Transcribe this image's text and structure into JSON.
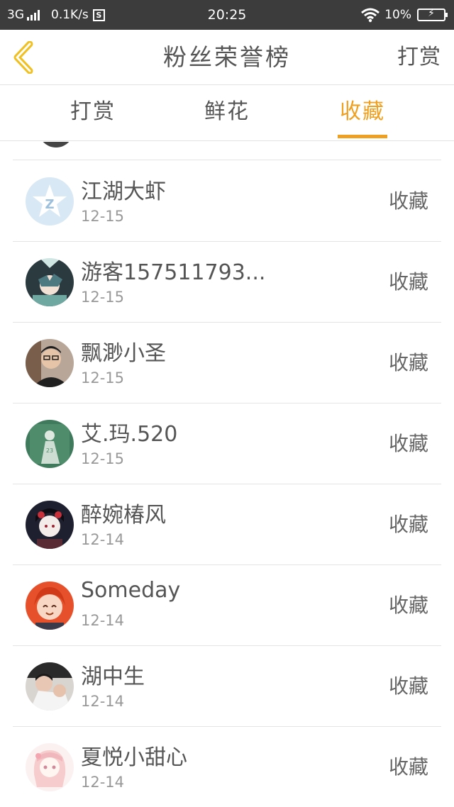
{
  "status_bar": {
    "network": "3G",
    "speed": "0.1K/s",
    "s_badge": "S",
    "time": "20:25",
    "battery": "10%"
  },
  "navbar": {
    "title": "粉丝荣誉榜",
    "action": "打赏"
  },
  "tabs": [
    {
      "label": "打赏",
      "active": false
    },
    {
      "label": "鲜花",
      "active": false
    },
    {
      "label": "收藏",
      "active": true
    }
  ],
  "accent_color": "#f0a020",
  "list": [
    {
      "name": "江湖大虾",
      "date": "12-15",
      "action": "收藏",
      "avatar": "qq-default-avatar"
    },
    {
      "name": "游客157511793...",
      "date": "12-15",
      "action": "收藏",
      "avatar": "anime-wolf-avatar"
    },
    {
      "name": "飘渺小圣",
      "date": "12-15",
      "action": "收藏",
      "avatar": "photo-man-glasses-avatar"
    },
    {
      "name": "艾.玛.520",
      "date": "12-15",
      "action": "收藏",
      "avatar": "green-chalkboard-avatar"
    },
    {
      "name": "醉婉椿风",
      "date": "12-14",
      "action": "收藏",
      "avatar": "anime-geisha-avatar"
    },
    {
      "name": "Someday",
      "date": "12-14",
      "action": "收藏",
      "avatar": "anime-redhair-avatar"
    },
    {
      "name": "湖中生",
      "date": "12-14",
      "action": "收藏",
      "avatar": "photo-baby-avatar"
    },
    {
      "name": "夏悦小甜心",
      "date": "12-14",
      "action": "收藏",
      "avatar": "anime-pink-girl-avatar"
    }
  ]
}
